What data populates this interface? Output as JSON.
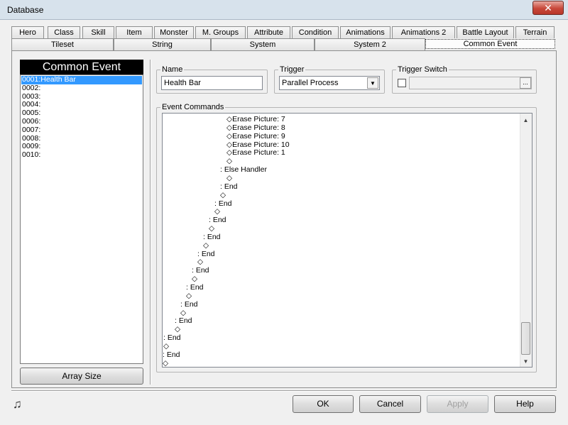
{
  "window": {
    "title": "Database",
    "close_glyph": "✕"
  },
  "tabs_row1": [
    "Hero",
    "Class",
    "Skill",
    "Item",
    "Monster",
    "M. Groups",
    "Attribute",
    "Condition",
    "Animations",
    "Animations 2",
    "Battle Layout",
    "Terrain"
  ],
  "tabs_row2": [
    "Tileset",
    "String",
    "System",
    "System 2",
    "Common Event"
  ],
  "active_tab": "Common Event",
  "left_panel": {
    "header": "Common Event",
    "items": [
      "0001:Health Bar",
      "0002:",
      "0003:",
      "0004:",
      "0005:",
      "0006:",
      "0007:",
      "0008:",
      "0009:",
      "0010:"
    ],
    "selected_index": 0,
    "array_size_label": "Array Size"
  },
  "name_group": {
    "label": "Name",
    "value": "Health Bar"
  },
  "trigger_group": {
    "label": "Trigger",
    "value": "Parallel Process"
  },
  "trigger_switch_group": {
    "label": "Trigger Switch",
    "checked": false,
    "browse_label": "..."
  },
  "event_commands": {
    "label": "Event Commands",
    "lines": [
      "◇Erase Picture: 7",
      "◇Erase Picture: 8",
      "◇Erase Picture: 9",
      "◇Erase Picture: 10",
      "◇Erase Picture: 1",
      "◇",
      ": Else Handler",
      "◇",
      ": End",
      "◇",
      ": End",
      "◇",
      ": End",
      "◇",
      ": End",
      "◇",
      ": End",
      "◇",
      ": End",
      "◇",
      ": End",
      "◇",
      ": End",
      "◇",
      ": End",
      "◇",
      ": End",
      "◇",
      ": End",
      "◇"
    ]
  },
  "buttons": {
    "ok": "OK",
    "cancel": "Cancel",
    "apply": "Apply",
    "help": "Help"
  },
  "icons": {
    "music": "music-note-icon",
    "dropdown": "chevron-down-icon",
    "scroll_up": "scroll-up-arrow-icon",
    "scroll_down": "scroll-down-arrow-icon"
  }
}
